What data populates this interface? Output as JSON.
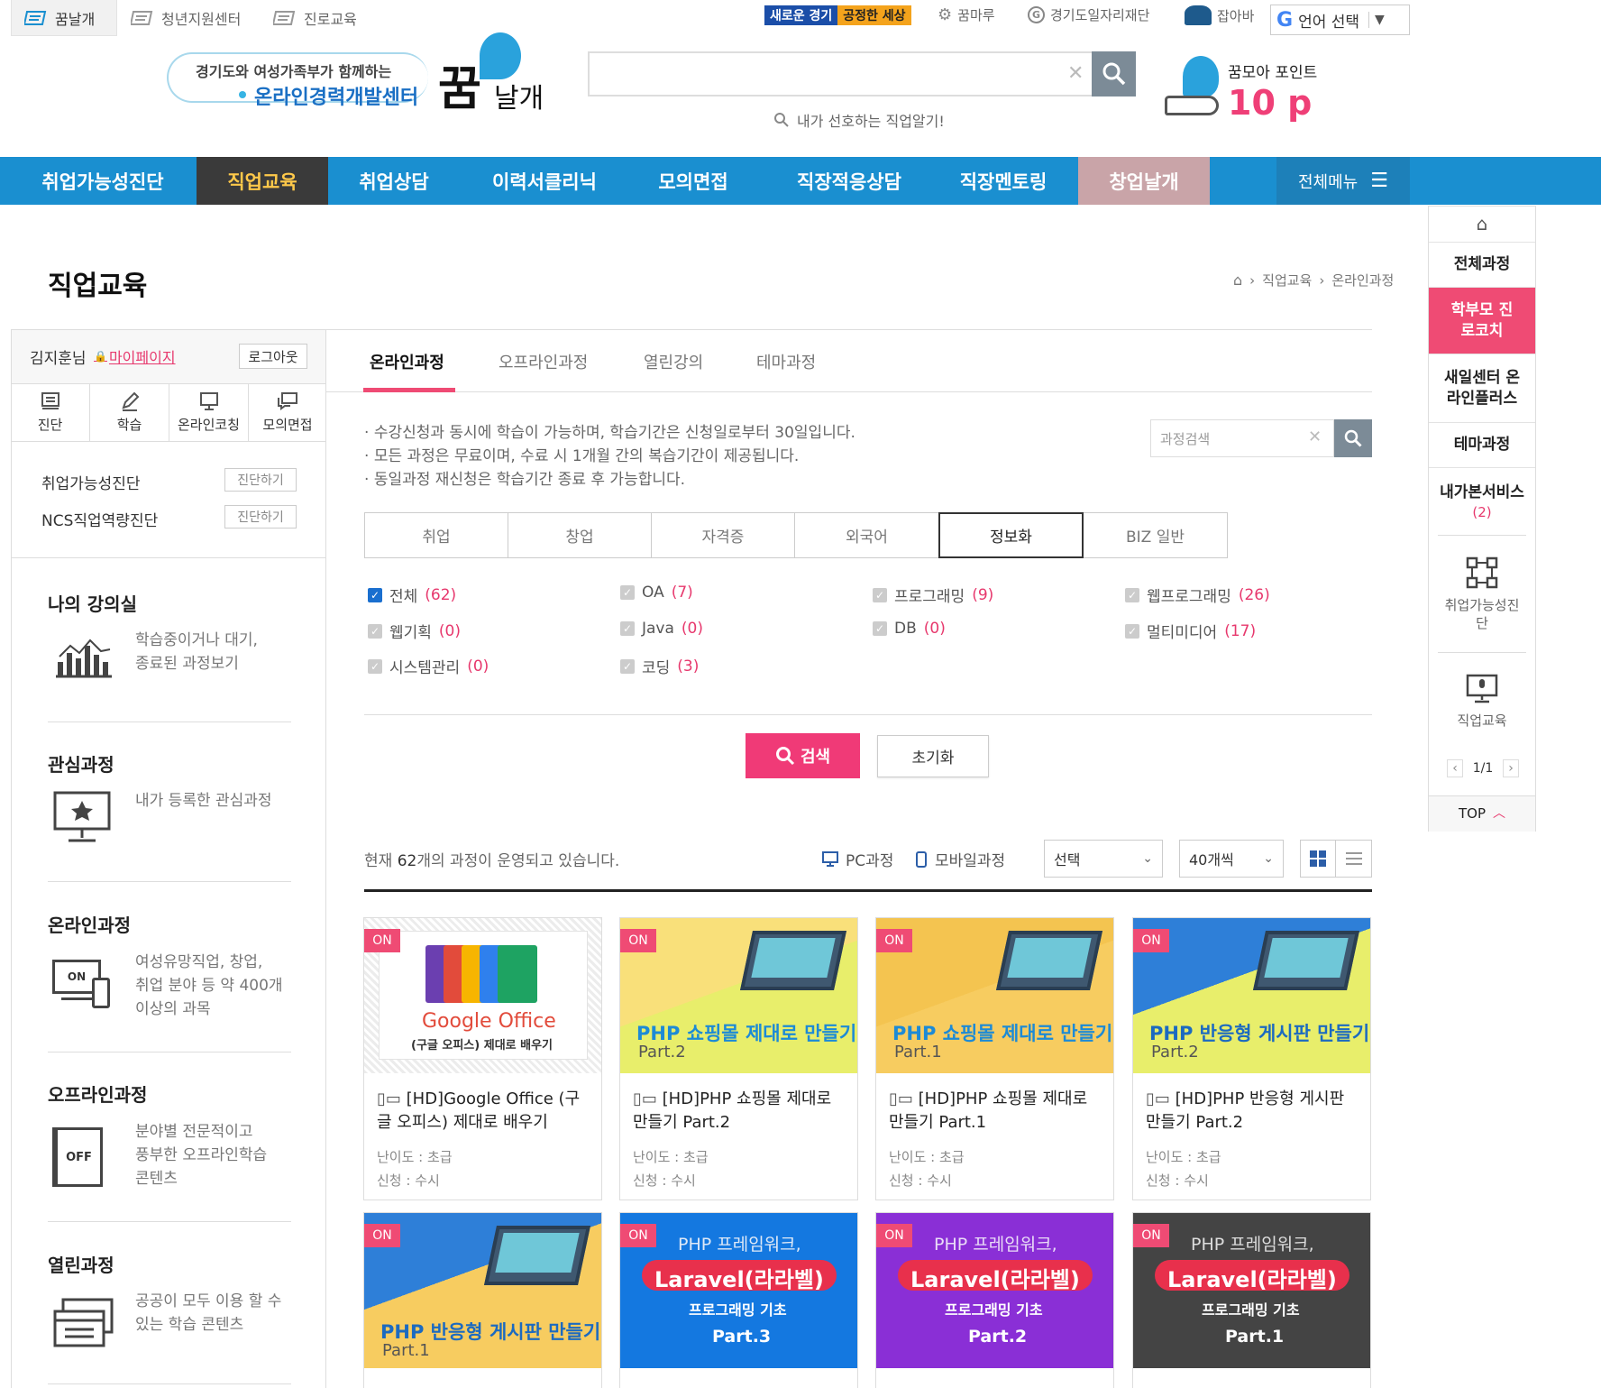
{
  "topbar": {
    "tabs": [
      "꿈날개",
      "청년지원센터",
      "진로교육"
    ],
    "badge1": "새로운 경기",
    "badge2": "공정한 세상",
    "links": [
      "꿈마루",
      "경기도일자리재단",
      "잡아바"
    ],
    "lang_label": "언어 선택",
    "lang_arrow": "▼"
  },
  "header": {
    "slogan_line1": "경기도와 여성가족부가 함께하는",
    "slogan_line2": "온라인경력개발센터",
    "logo_text1": "꿈",
    "logo_text2": "날개",
    "search_hint": "내가 선호하는 직업알기!",
    "point_label": "꿈모아 포인트",
    "point_value": "10 p"
  },
  "gnb": {
    "items": [
      "취업가능성진단",
      "직업교육",
      "취업상담",
      "이력서클리닉",
      "모의면접",
      "직장적응상담",
      "직장멘토링",
      "창업날개"
    ],
    "all_menu": "전체메뉴"
  },
  "page": {
    "title": "직업교육",
    "breadcrumb": [
      "직업교육",
      "온라인과정"
    ]
  },
  "sidebar": {
    "user_name": "김지훈님",
    "mypage": "마이페이지",
    "logout": "로그아웃",
    "icon_tabs": [
      "진단",
      "학습",
      "온라인코칭",
      "모의면접"
    ],
    "diag_rows": [
      {
        "label": "취업가능성진단",
        "button": "진단하기"
      },
      {
        "label": "NCS직업역량진단",
        "button": "진단하기"
      }
    ],
    "menus": [
      {
        "title": "나의 강의실",
        "desc": [
          "학습중이거나 대기,",
          "종료된 과정보기"
        ]
      },
      {
        "title": "관심과정",
        "desc": [
          "내가 등록한 관심과정"
        ]
      },
      {
        "title": "온라인과정",
        "desc": [
          "여성유망직업, 창업,",
          "취업 분야 등 약 400개",
          "이상의 과목"
        ]
      },
      {
        "title": "오프라인과정",
        "desc": [
          "분야별 전문적이고",
          "풍부한 오프라인학습",
          "콘텐츠"
        ]
      },
      {
        "title": "열린과정",
        "desc": [
          "공공이 모두 이용 할 수",
          "있는 학습 콘텐츠"
        ]
      }
    ],
    "icon_on": "ON",
    "icon_off": "OFF"
  },
  "content": {
    "tabs": [
      "온라인과정",
      "오프라인과정",
      "열린강의",
      "테마과정"
    ],
    "notices": [
      "수강신청과 동시에 학습이 가능하며, 학습기간은 신청일로부터 30일입니다.",
      "모든 과정은 무료이며, 수료 시 1개월 간의 복습기간이 제공됩니다.",
      "동일과정 재신청은 학습기간 종료 후 가능합니다."
    ],
    "course_search_placeholder": "과정검색",
    "categories": [
      "취업",
      "창업",
      "자격증",
      "외국어",
      "정보화",
      "BIZ 일반"
    ],
    "checks": [
      {
        "label": "전체",
        "count": "(62)",
        "checked": true
      },
      {
        "label": "OA",
        "count": "(7)",
        "checked": false
      },
      {
        "label": "프로그래밍",
        "count": "(9)",
        "checked": false
      },
      {
        "label": "웹프로그래밍",
        "count": "(26)",
        "checked": false
      },
      {
        "label": "웹기획",
        "count": "(0)",
        "checked": false
      },
      {
        "label": "Java",
        "count": "(0)",
        "checked": false
      },
      {
        "label": "DB",
        "count": "(0)",
        "checked": false
      },
      {
        "label": "멀티미디어",
        "count": "(17)",
        "checked": false
      },
      {
        "label": "시스템관리",
        "count": "(0)",
        "checked": false
      },
      {
        "label": "코딩",
        "count": "(3)",
        "checked": false
      }
    ],
    "search_button": "검색",
    "reset_button": "초기화",
    "count_prefix": "현재 ",
    "count_number": "62",
    "count_suffix": "개의 과정이 운영되고 있습니다.",
    "pc_label": "PC과정",
    "mobile_label": "모바일과정",
    "sort_select": "선택",
    "per_page_select": "40개씩"
  },
  "cards": [
    {
      "badge": "ON",
      "title": "[HD]Google Office (구글 오피스) 제대로 배우기",
      "level": "난이도 : 초급",
      "apply": "신청 : 수시",
      "thumb_line1": "Google Office",
      "thumb_line2": "(구글 오피스) 제대로 배우기"
    },
    {
      "badge": "ON",
      "title": "[HD]PHP 쇼핑몰 제대로 만들기 Part.2",
      "level": "난이도 : 초급",
      "apply": "신청 : 수시",
      "thumb_line1": "PHP 쇼핑몰 제대로 만들기",
      "thumb_line2": "Part.2"
    },
    {
      "badge": "ON",
      "title": "[HD]PHP 쇼핑몰 제대로 만들기 Part.1",
      "level": "난이도 : 초급",
      "apply": "신청 : 수시",
      "thumb_line1": "PHP 쇼핑몰 제대로 만들기",
      "thumb_line2": "Part.1"
    },
    {
      "badge": "ON",
      "title": "[HD]PHP 반응형 게시판 만들기 Part.2",
      "level": "난이도 : 초급",
      "apply": "신청 : 수시",
      "thumb_line1": "PHP 반응형 게시판 만들기",
      "thumb_line2": "Part.2"
    },
    {
      "badge": "ON",
      "thumb_line1": "PHP 반응형 게시판 만들기",
      "thumb_line2": "Part.1"
    },
    {
      "badge": "ON",
      "thumb_line0": "PHP 프레임워크,",
      "thumb_line1": "Laravel(라라벨)",
      "thumb_line2": "프로그래밍 기초",
      "thumb_line3": "Part.3"
    },
    {
      "badge": "ON",
      "thumb_line0": "PHP 프레임워크,",
      "thumb_line1": "Laravel(라라벨)",
      "thumb_line2": "프로그래밍 기초",
      "thumb_line3": "Part.2"
    },
    {
      "badge": "ON",
      "thumb_line0": "PHP 프레임워크,",
      "thumb_line1": "Laravel(라라벨)",
      "thumb_line2": "프로그래밍 기초",
      "thumb_line3": "Part.1"
    }
  ],
  "quick": {
    "items": [
      "전체과정",
      "학부모 진로코치",
      "새일센터 온라인플러스",
      "테마과정"
    ],
    "my_service": "내가본서비스",
    "my_service_count": "(2)",
    "recent": [
      "취업가능성진단",
      "직업교육"
    ],
    "pager": "1/1",
    "top": "TOP"
  },
  "colors": {
    "gnb": "#1a8fd0",
    "gnb_active": "#3a3a3a",
    "gnb_pink": "#c9a4a8",
    "accent": "#e7386d",
    "pink": "#ef4b74"
  }
}
